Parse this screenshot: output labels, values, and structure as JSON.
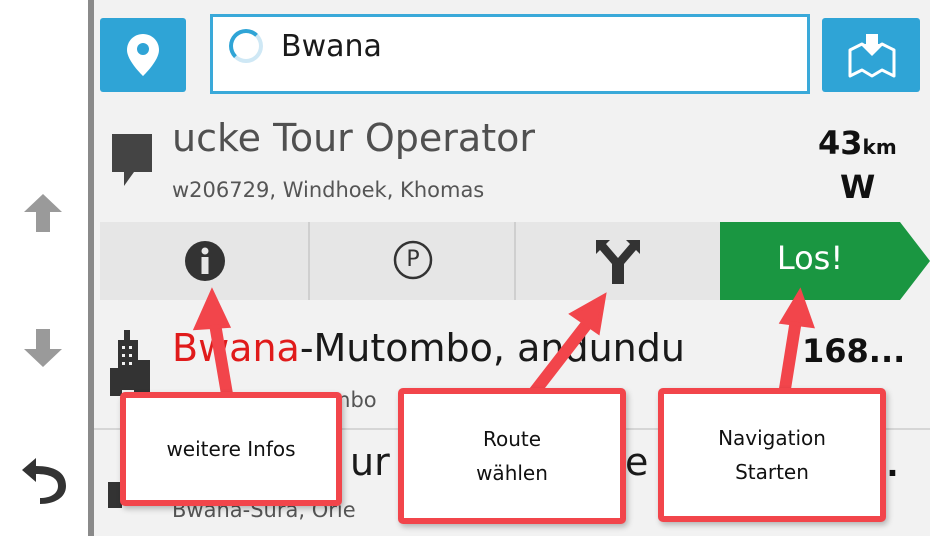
{
  "search": {
    "query": "Bwana"
  },
  "current_result": {
    "title": "ucke Tour Operator",
    "subtitle": "w206729, Windhoek, Khomas",
    "distance_value": "43",
    "distance_unit": "km",
    "direction": "W"
  },
  "actions": {
    "info_icon": "info-icon",
    "parking_label": "P",
    "route_icon": "route-fork-icon",
    "go_label": "Los!",
    "go_color": "#1a9641"
  },
  "result_2": {
    "title_highlight_partial": "Bw",
    "title_highlight_rest": "ana",
    "title_rest": "-Mutombo, ",
    "title_tail": "andundu",
    "subtitle_partial": "mbo",
    "distance": "168..."
  },
  "result_3": {
    "title_partial": "ur",
    "title_tail": "e",
    "subtitle": "Bwana-Sura, Orie",
    "distance": "..."
  },
  "callouts": {
    "info": "weitere Infos",
    "route": "Route\nwählen",
    "navigation": "Navigation\nStarten"
  },
  "colors": {
    "accent_blue": "#2fa4d6",
    "callout_red": "#f2454b",
    "highlight_red": "#e01b1b"
  }
}
